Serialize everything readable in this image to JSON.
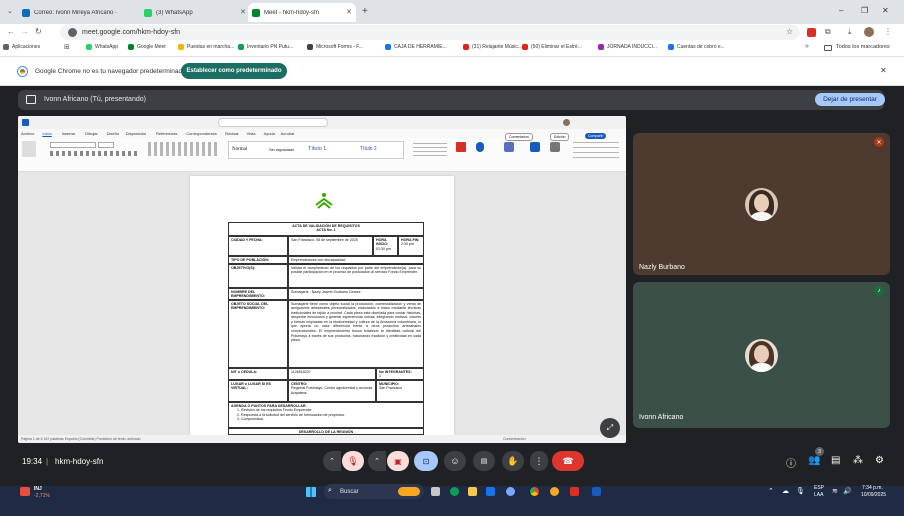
{
  "browser": {
    "tabs": [
      {
        "label": "Correo: Ivonn Mireya Africano ·",
        "color": "#0f6cbd"
      },
      {
        "label": "(3) WhatsApp",
        "color": "#25d366"
      },
      {
        "label": "Meet - hkm-hdoy-sfn",
        "color": "#00832d"
      }
    ],
    "new_tab": "+",
    "url": "meet.google.com/hkm-hdoy-sfn",
    "window_controls": [
      "–",
      "❐",
      "✕"
    ],
    "bookmarks": [
      {
        "label": "Aplicaciones",
        "color": "#5f6368"
      },
      {
        "label": "WhatsApp",
        "color": "#25d366"
      },
      {
        "label": "Google Meet",
        "color": "#00832d"
      },
      {
        "label": "Puestas en marcha...",
        "color": "#f4b400"
      },
      {
        "label": "Inventario PN Putu...",
        "color": "#0f9d58"
      },
      {
        "label": "Microsoft Forms - F...",
        "color": "#444"
      },
      {
        "label": "CAJA DE HERRAMIE...",
        "color": "#1a73e8"
      },
      {
        "label": "(31) Relajante Músic...",
        "color": "#e62117"
      },
      {
        "label": "(50) Eliminar el Estré...",
        "color": "#e62117"
      },
      {
        "label": "JORNADA INDUCCI...",
        "color": "#9c27b0"
      },
      {
        "label": "Cuentas de cobro e...",
        "color": "#1a73e8"
      }
    ],
    "bookmarks_more": "»",
    "all_bookmarks": "Todos los marcadores",
    "infobar_text": "Google Chrome no es tu navegador predeterminado",
    "infobar_button": "Establecer como predeterminado"
  },
  "meet": {
    "presenter_label": "Ivonn Africano (Tú, presentando)",
    "stop_presenting": "Dejar de presentar",
    "time": "19:34",
    "separator": "|",
    "meeting_code": "hkm-hdoy-sfn",
    "participants": [
      {
        "name": "Nazly Burbano",
        "tile_color": "#4e3a2e",
        "mic_color": "#a93b1a",
        "mic_glyph": "✕"
      },
      {
        "name": "Ivonn Africano",
        "tile_color": "#3b5148",
        "mic_color": "#1e6b3d",
        "mic_glyph": "♪"
      }
    ],
    "people_count": "3"
  },
  "word": {
    "menu": [
      "Archivo",
      "Inicio",
      "Insertar",
      "Dibujar",
      "Diseño",
      "Disposición",
      "Referencias",
      "Correspondencia",
      "Revisar",
      "Vista",
      "Ayuda",
      "Acrobat"
    ],
    "styles": [
      "Normal",
      "Sin espaciado",
      "Título 1",
      "Título 2"
    ],
    "comments_btn": "Comentarios",
    "editing_btn": "Edición",
    "share_btn": "Compartir",
    "status_left": "Página 1 de 6   167 palabras   Español (Colombia)   Prediction de texto: activado",
    "status_right": "Concentración"
  },
  "document": {
    "title": "ACTA DE VALIDACIÓN DE REQUISITOS",
    "subtitle": "ACTA No. 1",
    "ciudad_label": "CIUDAD Y FECHA:",
    "ciudad_value": "San Francisco, 08 de septiembre de 2025",
    "hora_inicio_label": "HORA INICIO:",
    "hora_inicio_value": "01:30 pm",
    "hora_fin_label": "HORA FIN:",
    "hora_fin_value": "2:30 pm",
    "tipo_label": "TIPO DE POBLACIÓN:",
    "tipo_value": "Emprendedores con discapacidad",
    "objetivo_label": "OBJETIVO(S):",
    "objetivo_value": "Validar el cumplimiento de los requisitos por parte del emprendedor(a), para su posible participación en el proceso de postulación al servicio Fondo Emprender.",
    "nombre_label": "NOMBRE DEL EMPRENDIMIENTO:",
    "nombre_value": "Sumaqarte - Nazly Jazmín Burbano Gómez",
    "objeto_label": "OBJETO SOCIAL DEL EMPRENDIMIENTO:",
    "objeto_value": "Sumaqarte tiene como objeto social la producción, comercialización y venta de amigurumis artesanales personalizados, elaborados a mano mediante técnicas tradicionales de tejido a crochet. Cada pieza está diseñada para contar historias, despertar emociones y generar experiencias únicas, integrando motivos, colores y formas inspiradas en la biodiversidad y cultura de la Amazonía colombiana, lo que aporta un valor diferencial frente a otros productos artesanales convencionales. El emprendimiento busca fortalecer la identidad cultural del Putumayo a través de sus productos, fusionando tradición y creatividad en cada pieza.",
    "nit_label": "NIT o CEDULA:",
    "nit_value": "1126518237",
    "integrantes_label": "No INTEGRANTES:",
    "integrantes_value": "1",
    "lugar_label": "LUGAR o LUGAR SI ES VIRTUAL:",
    "centro_label": "CENTRO:",
    "centro_value": "Regional Putumayo, Centro agroforestal y acuícola Arapaima.",
    "municipio_label": "MUNICIPIO:",
    "municipio_value": "San Francisco",
    "agenda_label": "AGENDA O PUNTOS PARA DESARROLLAR:",
    "agenda": [
      "1.   Revisión de los requisitos Fondo Emprender",
      "2.   Respuesta a la solicitud del servicio de formulación de proyectos.",
      "3.   Compromisos"
    ],
    "desarrollo": "DESARROLLO DE LA REUNIÓN"
  },
  "taskbar": {
    "weather_line1": "INJ",
    "weather_line2": "-2,71%",
    "search_placeholder": "Buscar",
    "lang": "ESP",
    "lang2": "LAA",
    "clock_time": "7:34 p.m.",
    "clock_date": "10/09/2025"
  }
}
